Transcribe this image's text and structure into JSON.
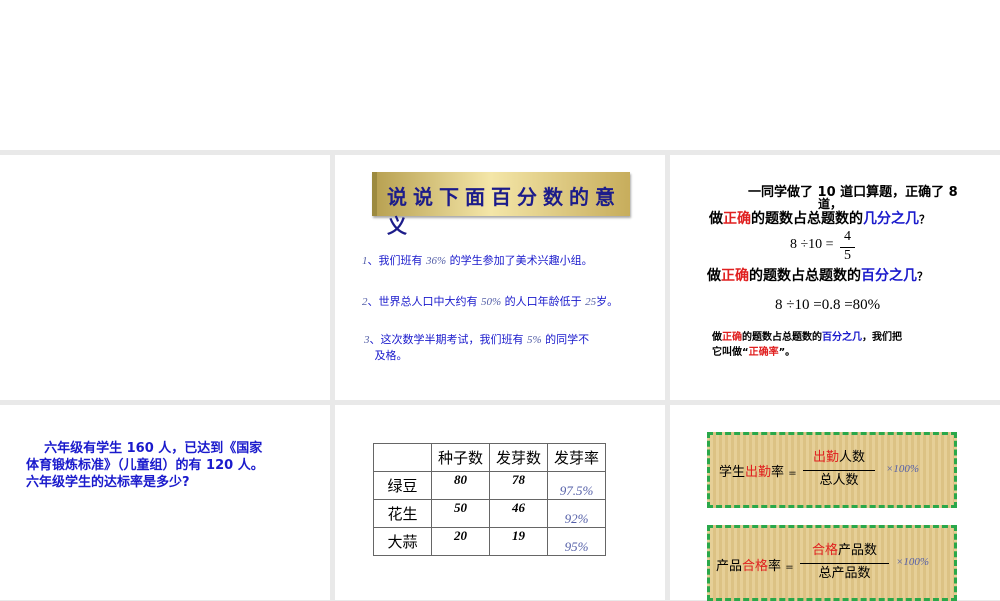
{
  "slide2": {
    "title": "说说下面百分数的意义",
    "items": [
      {
        "n": "1",
        "a": "、我们班有",
        "p": "36%",
        "b": "的学生参加了美术兴趣小组。"
      },
      {
        "n": "2",
        "a": "、世界总人口中大约有",
        "p": "50%",
        "b": "的人口年龄低于",
        "c": "25",
        "d": "岁。"
      },
      {
        "n": "3",
        "a": "、这次数学半期考试，我们班有",
        "p": "5%",
        "b": "的同学不",
        "e": "及格。"
      }
    ]
  },
  "slide3": {
    "line1": "一同学做了 10 道口算题，正确了 8",
    "line1b": "道，",
    "q_pre": "做",
    "q_red": "正确",
    "q_mid": "的题数占总题数的",
    "q1_blue": "几分之几",
    "q_end": "？",
    "eq1_left": "8 ÷10 =",
    "eq1_num": "4",
    "eq1_den": "5",
    "q2_blue": "百分之几",
    "eq2": "8 ÷10 =0.8 =80%",
    "s_end": "，我们把",
    "s_line2a": "它叫做“",
    "s_term": "正确率",
    "s_line2b": "”。"
  },
  "slide4": {
    "text_a": "六年级有学生 160 人，已达到《国家",
    "text_b": "体育锻炼标准》（儿童组）的有 120 人。",
    "text_c": "六年级学生的达标率是多少?"
  },
  "slide5": {
    "headers": [
      "",
      "种子数",
      "发芽数",
      "发芽率"
    ],
    "rows": [
      [
        "绿豆",
        "80",
        "78",
        "97.5%"
      ],
      [
        "花生",
        "50",
        "46",
        "92%"
      ],
      [
        "大蒜",
        "20",
        "19",
        "95%"
      ]
    ]
  },
  "slide6": {
    "f1": {
      "a": "学生",
      "red": "出勤",
      "b": "率",
      "eq": "=",
      "num_red": "出勤",
      "num": "人数",
      "den": "总人数",
      "mult": "×100%"
    },
    "f2": {
      "a": "产品",
      "red": "合格",
      "b": "率",
      "eq": "=",
      "num_red": "合格",
      "num": "产品数",
      "den": "总产品数",
      "mult": "×100%"
    }
  }
}
